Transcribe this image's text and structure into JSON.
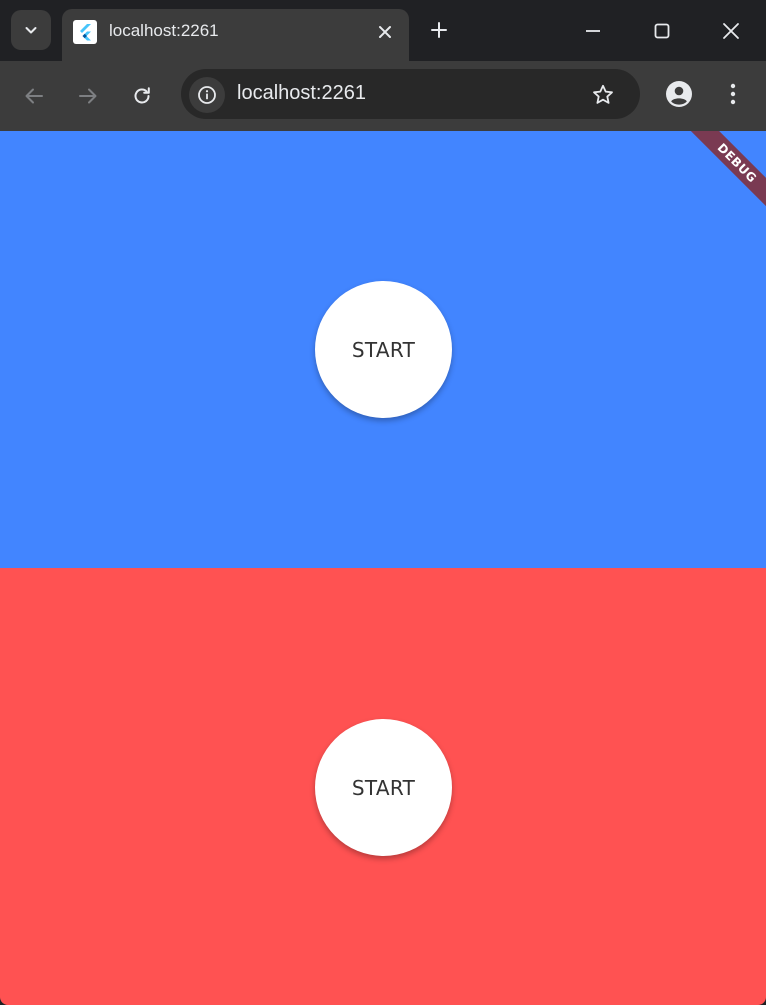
{
  "browser": {
    "tab": {
      "title": "localhost:2261",
      "favicon": "flutter-logo-icon"
    },
    "address_bar": {
      "url": "localhost:2261"
    },
    "icons": {
      "tab_search": "chevron-down-icon",
      "tab_close": "close-icon",
      "new_tab": "plus-icon",
      "minimize": "minimize-icon",
      "maximize": "maximize-icon",
      "window_close": "close-icon",
      "back": "arrow-left-icon",
      "forward": "arrow-right-icon",
      "reload": "reload-icon",
      "site_info": "info-icon",
      "bookmark": "star-icon",
      "profile": "person-icon",
      "menu": "more-vertical-icon"
    }
  },
  "app": {
    "debug_banner": "DEBUG",
    "top_player": {
      "button_label": "START",
      "color": "#4285FF"
    },
    "bottom_player": {
      "button_label": "START",
      "color": "#FF5252"
    }
  },
  "colors": {
    "frame": "#202124",
    "toolbar": "#3C3C3C",
    "omnibox": "#282828",
    "debug_ribbon": "#7A3A52"
  }
}
